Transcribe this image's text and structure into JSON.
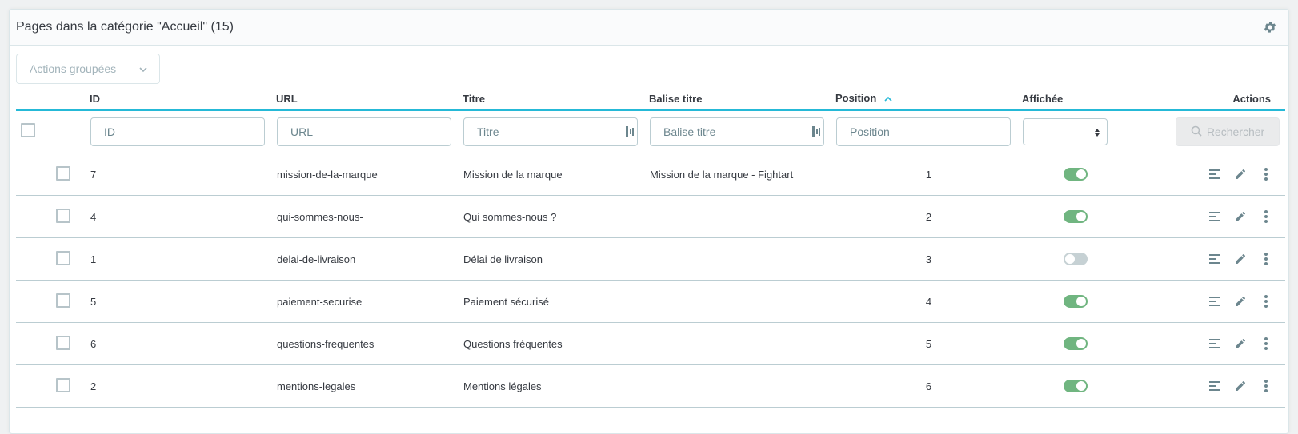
{
  "header": {
    "title": "Pages dans la catégorie \"Accueil\" (15)",
    "settings_icon": "gear-icon"
  },
  "bulk_actions": {
    "label": "Actions groupées"
  },
  "columns": {
    "id": "ID",
    "url": "URL",
    "title": "Titre",
    "meta_title": "Balise titre",
    "position": "Position",
    "displayed": "Affichée",
    "actions": "Actions"
  },
  "filters": {
    "id_placeholder": "ID",
    "url_placeholder": "URL",
    "title_placeholder": "Titre",
    "meta_title_placeholder": "Balise titre",
    "position_placeholder": "Position",
    "displayed_value": "",
    "search_label": "Rechercher"
  },
  "rows": [
    {
      "id": "7",
      "url": "mission-de-la-marque",
      "title": "Mission de la marque",
      "meta_title": "Mission de la marque - Fightart",
      "position": "1",
      "displayed": true
    },
    {
      "id": "4",
      "url": "qui-sommes-nous-",
      "title": "Qui sommes-nous ?",
      "meta_title": "",
      "position": "2",
      "displayed": true
    },
    {
      "id": "1",
      "url": "delai-de-livraison",
      "title": "Délai de livraison",
      "meta_title": "",
      "position": "3",
      "displayed": false
    },
    {
      "id": "5",
      "url": "paiement-securise",
      "title": "Paiement sécurisé",
      "meta_title": "",
      "position": "4",
      "displayed": true
    },
    {
      "id": "6",
      "url": "questions-frequentes",
      "title": "Questions fréquentes",
      "meta_title": "",
      "position": "5",
      "displayed": true
    },
    {
      "id": "2",
      "url": "mentions-legales",
      "title": "Mentions légales",
      "meta_title": "",
      "position": "6",
      "displayed": true
    }
  ],
  "colors": {
    "accent": "#25b9d7",
    "toggle_on": "#70b580",
    "toggle_off": "#c6d1d4",
    "border": "#bbcdd2"
  }
}
